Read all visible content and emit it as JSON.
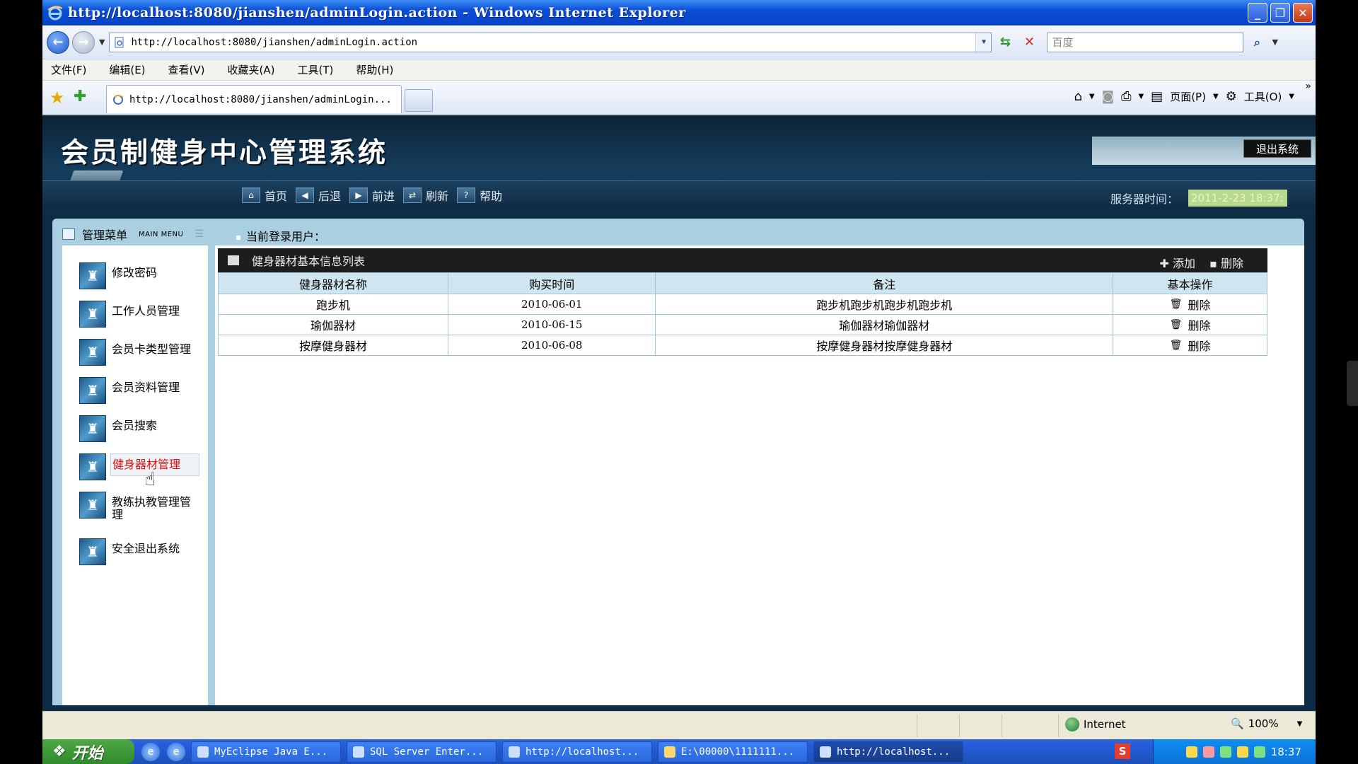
{
  "browser": {
    "window_title": "http://localhost:8080/jianshen/adminLogin.action - Windows Internet Explorer",
    "address": "http://localhost:8080/jianshen/adminLogin.action",
    "search_placeholder": "百度",
    "menu": [
      "文件(F)",
      "编辑(E)",
      "查看(V)",
      "收藏夹(A)",
      "工具(T)",
      "帮助(H)"
    ],
    "tab_title": "http://localhost:8080/jianshen/adminLogin...",
    "cmd_page": "页面(P)",
    "cmd_tools": "工具(O)",
    "status_zone": "Internet",
    "status_zoom": "100%"
  },
  "site": {
    "title": "会员制健身中心管理系统",
    "logout": "退出系统",
    "nav": [
      "首页",
      "后退",
      "前进",
      "刷新",
      "帮助"
    ],
    "server_time_label": "服务器时间：",
    "server_time_value": "2011-2-23 18:37:",
    "menu_title": "管理菜单",
    "menu_title_en": "MAIN MENU",
    "current_user_label": "当前登录用户：",
    "sidebar": [
      "修改密码",
      "工作人员管理",
      "会员卡类型管理",
      "会员资料管理",
      "会员搜索",
      "健身器材管理",
      "教练执教管理管理",
      "安全退出系统"
    ]
  },
  "list": {
    "title": "健身器材基本信息列表",
    "add_label": "添加",
    "delete_label": "删除",
    "columns": [
      "健身器材名称",
      "购买时间",
      "备注",
      "基本操作"
    ],
    "rows": [
      {
        "name": "跑步机",
        "date": "2010-06-01",
        "note": "跑步机跑步机跑步机跑步机",
        "op": "删除"
      },
      {
        "name": "瑜伽器材",
        "date": "2010-06-15",
        "note": "瑜伽器材瑜伽器材",
        "op": "删除"
      },
      {
        "name": "按摩健身器材",
        "date": "2010-06-08",
        "note": "按摩健身器材按摩健身器材",
        "op": "删除"
      }
    ]
  },
  "taskbar": {
    "start": "开始",
    "tasks": [
      "MyEclipse Java E...",
      "SQL Server Enter...",
      "http://localhost...",
      "E:\\00000\\1111111...",
      "http://localhost..."
    ],
    "clock": "18:37"
  }
}
